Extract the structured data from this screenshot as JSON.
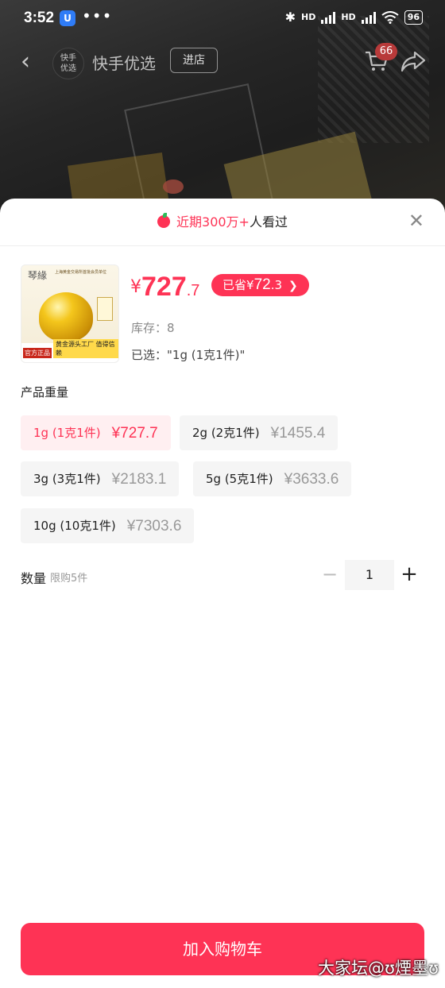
{
  "status": {
    "time": "3:52",
    "app_badge": "U",
    "dots": "•••",
    "hd1": "HD",
    "hd2": "HD",
    "battery": "96"
  },
  "nav": {
    "shop_logo_line1": "快手",
    "shop_logo_line2": "优选",
    "shop_name": "快手优选",
    "shop_button": "进店",
    "cart_count": "66"
  },
  "sheet": {
    "views_prefix": "近期300万+",
    "views_suffix": "人看过",
    "close": "✕",
    "thumb_brand": "琴緣",
    "thumb_top": "上海黄金交易所首批会员单位",
    "thumb_tag": "官方正品",
    "thumb_slogan": "黄金源头工厂 值得信赖",
    "price_currency": "¥",
    "price_int": "727",
    "price_dec": ".7",
    "save_label": "已省",
    "save_amount_cur": "¥",
    "save_amount_int": "72",
    "save_amount_dec": ".3",
    "stock": "库存：8",
    "selected": "已选：\"1g (1克1件)\"",
    "attr_title": "产品重量",
    "options": [
      {
        "label": "1g (1克1件)",
        "price": "¥727.7"
      },
      {
        "label": "2g (2克1件)",
        "price": "¥1455.4"
      },
      {
        "label": "3g (3克1件)",
        "price": "¥2183.1"
      },
      {
        "label": "5g (5克1件)",
        "price": "¥3633.6"
      },
      {
        "label": "10g (10克1件)",
        "price": "¥7303.6"
      }
    ],
    "qty_label": "数量",
    "qty_limit": "限购5件",
    "qty_minus": "−",
    "qty_value": "1",
    "qty_plus": "+",
    "cta": "加入购物车"
  },
  "watermark": "大家坛@ʊ煙墨ʊ",
  "colors": {
    "accent": "#fe3355",
    "accent_light": "#ffeff1"
  }
}
